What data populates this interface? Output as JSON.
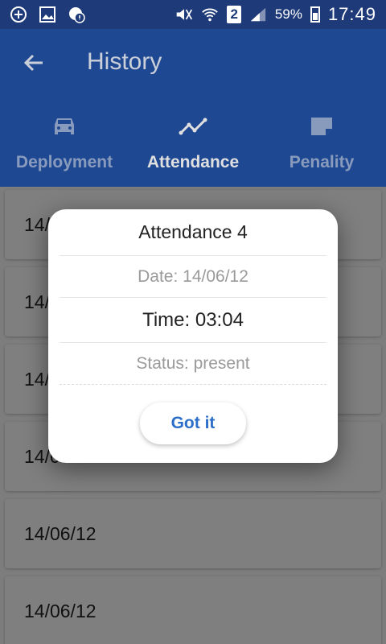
{
  "status_bar": {
    "battery_percent": "59%",
    "sim_slot": "2",
    "time": "17:49",
    "icons": [
      "add-circle-icon",
      "image-icon",
      "alert-icon",
      "mute-icon",
      "wifi-icon",
      "signal-icon",
      "battery-icon"
    ]
  },
  "app_bar": {
    "title": "History",
    "tabs": [
      {
        "label": "Deployment",
        "icon": "car-icon",
        "active": false
      },
      {
        "label": "Attendance",
        "icon": "trend-icon",
        "active": true
      },
      {
        "label": "Penality",
        "icon": "note-icon",
        "active": false
      }
    ]
  },
  "list": {
    "items": [
      {
        "date": "14/06/12"
      },
      {
        "date": "14/06/12"
      },
      {
        "date": "14/06/12"
      },
      {
        "date": "14/06/12"
      },
      {
        "date": "14/06/12"
      },
      {
        "date": "14/06/12"
      }
    ]
  },
  "dialog": {
    "title": "Attendance 4",
    "date": "Date: 14/06/12",
    "time": "Time: 03:04",
    "status": "Status: present",
    "button": "Got it"
  },
  "colors": {
    "status_bar": "#1e3a78",
    "app_bar": "#2453a7",
    "button_text": "#2c6fc9"
  }
}
